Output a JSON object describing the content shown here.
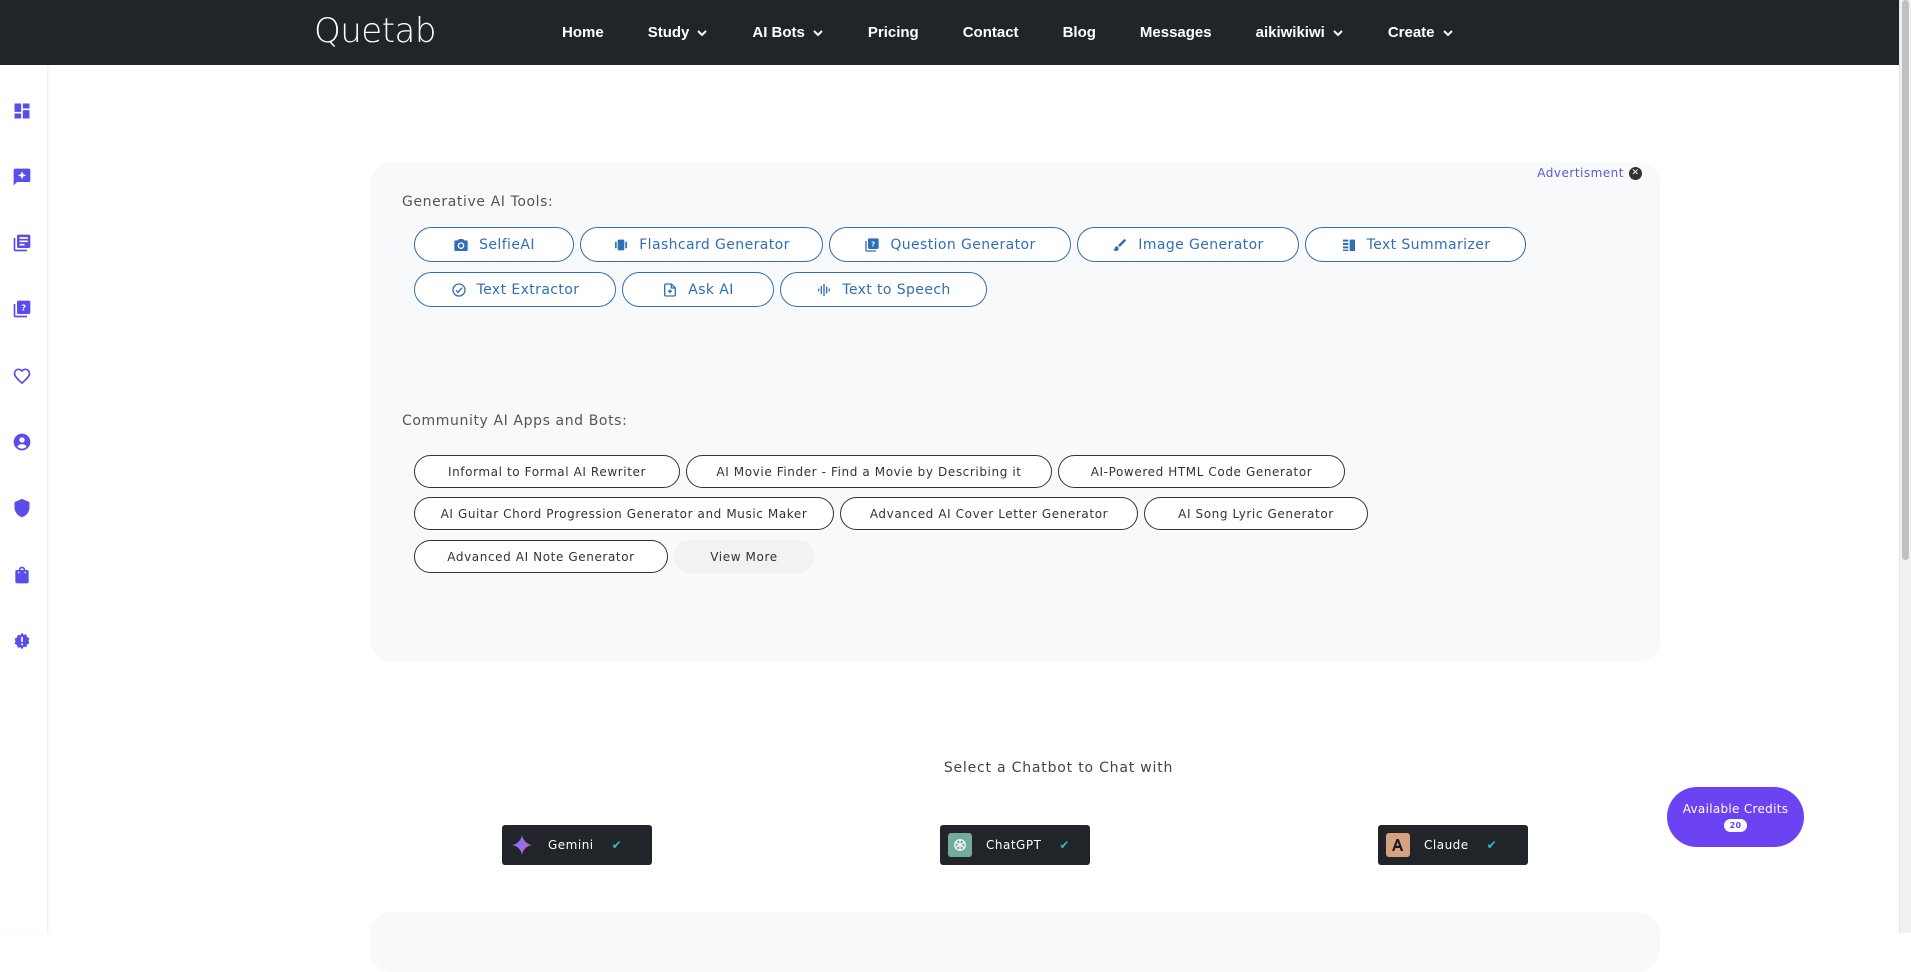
{
  "brand": {
    "logo_text": "Quetab"
  },
  "nav": {
    "items": [
      {
        "label": "Home",
        "has_dropdown": false
      },
      {
        "label": "Study",
        "has_dropdown": true
      },
      {
        "label": "AI Bots",
        "has_dropdown": true
      },
      {
        "label": "Pricing",
        "has_dropdown": false
      },
      {
        "label": "Contact",
        "has_dropdown": false
      },
      {
        "label": "Blog",
        "has_dropdown": false
      },
      {
        "label": "Messages",
        "has_dropdown": false
      },
      {
        "label": "aikiwikiwi",
        "has_dropdown": true
      },
      {
        "label": "Create",
        "has_dropdown": true
      }
    ]
  },
  "sidebar": {
    "icons": [
      "dashboard-icon",
      "sparkle-chat-icon",
      "library-icon",
      "quiz-icon",
      "heart-icon",
      "account-icon",
      "shield-icon",
      "shopping-bag-icon",
      "alert-gear-icon"
    ],
    "icon_color": "#5b4de8"
  },
  "tools_card": {
    "advertisement_label": "Advertisment",
    "generative_title": "Generative AI Tools:",
    "generative_tools": [
      {
        "label": "SelfieAI",
        "icon": "camera-icon"
      },
      {
        "label": "Flashcard Generator",
        "icon": "flashcard-icon"
      },
      {
        "label": "Question Generator",
        "icon": "question-icon"
      },
      {
        "label": "Image Generator",
        "icon": "brush-icon"
      },
      {
        "label": "Text Summarizer",
        "icon": "summary-icon"
      },
      {
        "label": "Text Extractor",
        "icon": "check-circle-icon"
      },
      {
        "label": "Ask AI",
        "icon": "ask-icon"
      },
      {
        "label": "Text to Speech",
        "icon": "waveform-icon"
      }
    ],
    "community_title": "Community AI Apps and Bots:",
    "community_apps": [
      "Informal to Formal AI Rewriter",
      "AI Movie Finder - Find a Movie by Describing it",
      "AI-Powered HTML Code Generator",
      "AI Guitar Chord Progression Generator and Music Maker",
      "Advanced AI Cover Letter Generator",
      "AI Song Lyric Generator",
      "Advanced AI Note Generator"
    ],
    "view_more_label": "View More"
  },
  "chatbots": {
    "title": "Select a Chatbot to Chat with",
    "bots": [
      {
        "label": "Gemini",
        "icon": "gemini-icon",
        "selected": true
      },
      {
        "label": "ChatGPT",
        "icon": "chatgpt-icon",
        "selected": true
      },
      {
        "label": "Claude",
        "icon": "claude-icon",
        "selected": true
      }
    ]
  },
  "credits": {
    "label": "Available Credits",
    "count": "20"
  },
  "colors": {
    "nav_bg": "#212529",
    "accent_purple": "#6c43f3",
    "tool_blue": "#2f6fb8",
    "check_teal": "#1ec2c2"
  }
}
